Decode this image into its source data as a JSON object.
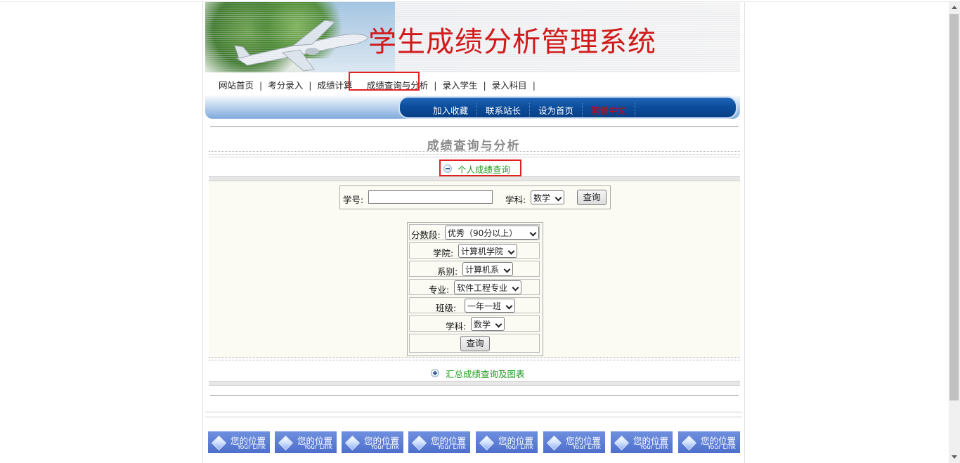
{
  "header": {
    "title": "学生成绩分析管理系统"
  },
  "nav": {
    "links": [
      "网站首页",
      "考分录入",
      "成绩计算",
      "成绩查询与分析",
      "录入学生",
      "录入科目"
    ],
    "separator": "|",
    "active": "成绩查询与分析"
  },
  "bar": {
    "links": [
      "加入收藏",
      "联系站长",
      "设为首页",
      "繁體中文"
    ]
  },
  "main": {
    "section_title": "成绩查询与分析",
    "personal_toggle": "个人成绩查询",
    "summary_toggle": "汇总成绩查询及图表",
    "search": {
      "student_id_label": "学号:",
      "student_id_value": "",
      "subject_label": "学科:",
      "subject_value": "数学",
      "query_button": "查询"
    },
    "filter": {
      "score_range_label": "分数段:",
      "score_range_value": "优秀（90分以上）",
      "college_label": "学院:",
      "college_value": "计算机学院",
      "department_label": "系别:",
      "department_value": "计算机系",
      "major_label": "专业:",
      "major_value": "软件工程专业",
      "class_label": "班级:",
      "class_value": "一年一班",
      "subject_label": "学科:",
      "subject_value": "数学",
      "query_button": "查询"
    }
  },
  "footer": {
    "buttons": [
      {
        "title": "您的位置",
        "sub": "Your Link"
      },
      {
        "title": "您的位置",
        "sub": "Your Link"
      },
      {
        "title": "您的位置",
        "sub": "Your Link"
      },
      {
        "title": "您的位置",
        "sub": "Your Link"
      },
      {
        "title": "您的位置",
        "sub": "Your Link"
      },
      {
        "title": "您的位置",
        "sub": "Your Link"
      },
      {
        "title": "您的位置",
        "sub": "Your Link"
      },
      {
        "title": "您的位置",
        "sub": "Your Link"
      }
    ]
  },
  "colors": {
    "title_red": "#d11a1a",
    "bar_blue": "#0d4e9d",
    "link_green": "#1f9a1f",
    "highlight_red": "#e12121"
  }
}
